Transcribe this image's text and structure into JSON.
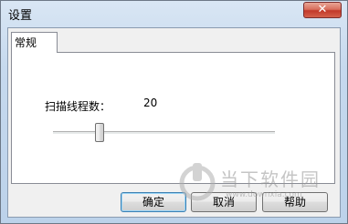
{
  "window": {
    "title": "设置",
    "close_label": "✕"
  },
  "tabs": [
    {
      "label": "常规",
      "active": true
    }
  ],
  "general": {
    "threads_label": "扫描线程数：",
    "threads_value": "20",
    "slider_level_fraction": 0.21
  },
  "buttons": {
    "ok": "确定",
    "cancel": "取消",
    "help": "帮助"
  },
  "watermark": {
    "text": "当下软件园",
    "url": "www.downxia.com"
  },
  "colors": {
    "close_button": "#c2392a",
    "titlebar": "#c6d9ee",
    "default_button_border": "#3c7fb1"
  }
}
